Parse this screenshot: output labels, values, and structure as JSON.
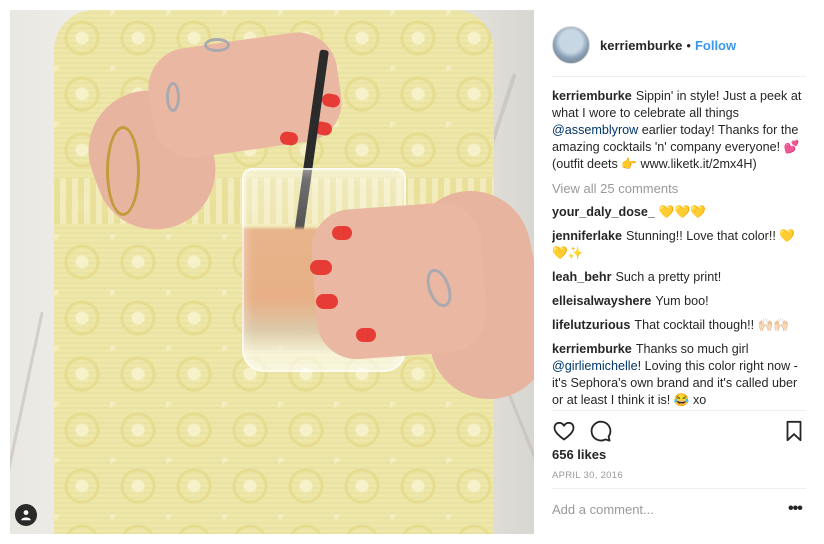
{
  "post": {
    "username": "kerriemburke",
    "follow_label": "Follow",
    "dot": "•",
    "caption_parts": {
      "text1": "Sippin' in style! Just a peek at what I wore to celebrate all things ",
      "mention": "@assemblyrow",
      "text2": " earlier today! Thanks for the amazing cocktails 'n' company everyone! 💕 (outfit deets 👉 www.liketk.it/2mx4H)"
    },
    "view_all_comments": "View all 25 comments",
    "comments": [
      {
        "user": "your_daly_dose_",
        "text": "💛💛💛"
      },
      {
        "user": "jenniferlake",
        "text": "Stunning!! Love that color!! 💛💛✨"
      },
      {
        "user": "leah_behr",
        "text": "Such a pretty print!"
      },
      {
        "user": "elleisalwayshere",
        "text": "Yum boo!"
      },
      {
        "user": "lifelutzurious",
        "text": "That cocktail though!! 🙌🏻🙌🏻"
      }
    ],
    "reply": {
      "user": "kerriemburke",
      "text1": "Thanks so much girl ",
      "mention": "@girliemichelle",
      "text2": "! Loving this color right now - it's Sephora's own brand and it's called uber or at least I think it is! 😂 xo"
    },
    "likes": "656 likes",
    "date": "APRIL 30, 2016",
    "add_comment_placeholder": "Add a comment...",
    "more_label": "•••"
  },
  "icons": {
    "like": "heart-icon",
    "comment": "comment-bubble-icon",
    "save": "bookmark-icon",
    "tag": "user-tag-icon"
  },
  "colors": {
    "link_blue": "#3897f0",
    "mention_blue": "#003569",
    "muted": "#999999",
    "text": "#262626",
    "nail_red": "#e63c35",
    "dress_yellow": "#eee7a8"
  }
}
